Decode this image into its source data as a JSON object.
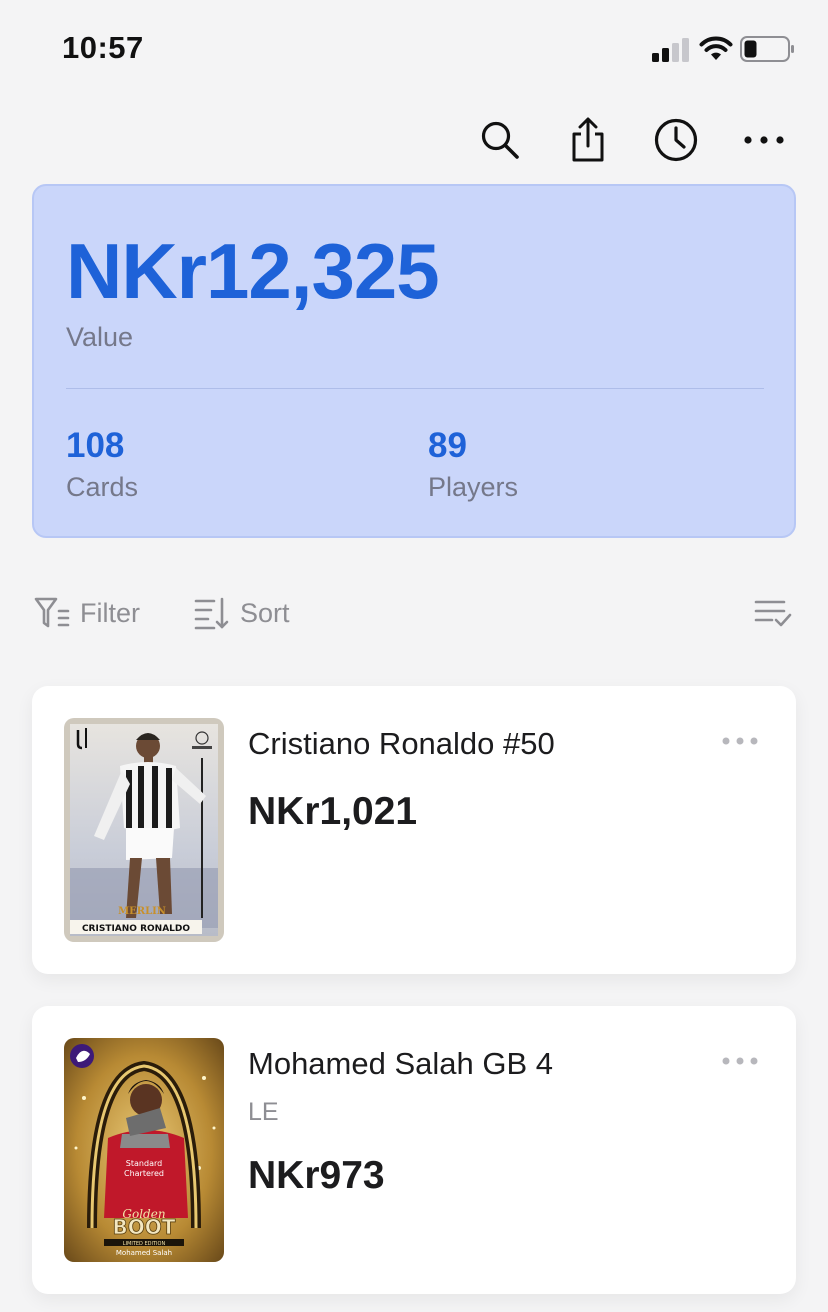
{
  "status_bar": {
    "time": "10:57"
  },
  "summary": {
    "total_value": "NKr12,325",
    "value_label": "Value",
    "cards_count": "108",
    "cards_label": "Cards",
    "players_count": "89",
    "players_label": "Players"
  },
  "filters": {
    "filter_label": "Filter",
    "sort_label": "Sort"
  },
  "cards": [
    {
      "title": "Cristiano Ronaldo #50",
      "price": "NKr1,021",
      "thumb_caption": "CRISTIANO RONALDO",
      "thumb_brand": "MERLIN"
    },
    {
      "title": "Mohamed Salah GB 4",
      "subtitle": "LE",
      "price": "NKr973",
      "thumb_caption": "Mohamed Salah",
      "thumb_brand": "BOOT"
    }
  ],
  "colors": {
    "accent": "#1e62d8",
    "summary_bg": "#cad6fa",
    "muted": "#8e8e93"
  }
}
